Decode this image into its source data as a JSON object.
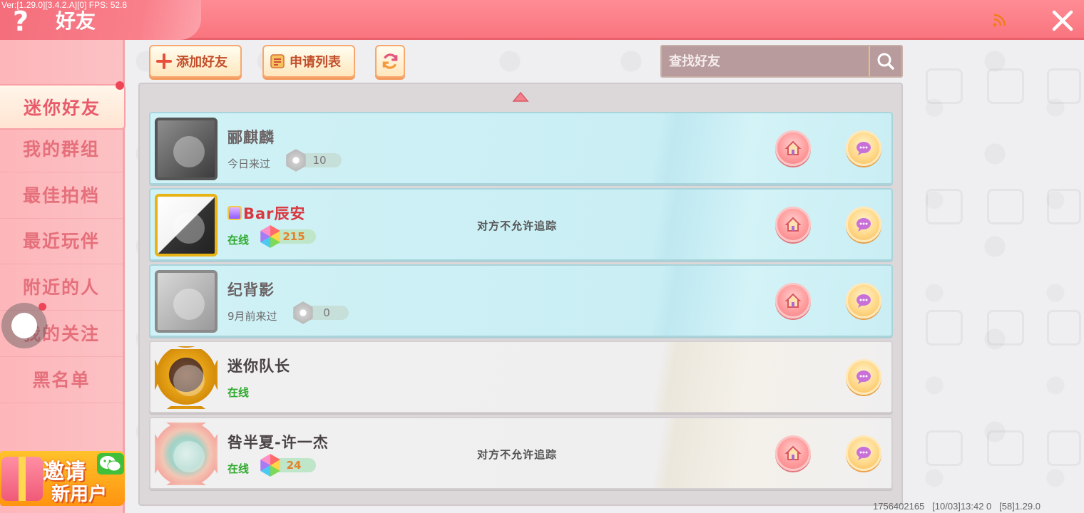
{
  "header": {
    "version_text": "Ver:[1.29.0][3.4.2.A][0] FPS: 52.8",
    "title": "好友",
    "help_icon": "question-mark-icon",
    "signal_icon": "signal-icon",
    "close_icon": "close-icon"
  },
  "sidebar": {
    "items": [
      {
        "label": "迷你好友",
        "active": true
      },
      {
        "label": "我的群组"
      },
      {
        "label": "最佳拍档"
      },
      {
        "label": "最近玩伴"
      },
      {
        "label": "附近的人"
      },
      {
        "label": "我的关注"
      },
      {
        "label": "黑名单"
      }
    ],
    "invite": {
      "line1": "邀请",
      "line2": "新用户"
    }
  },
  "toolbar": {
    "add_friend": "添加好友",
    "request_list": "申请列表",
    "search_placeholder": "查找好友"
  },
  "friends": [
    {
      "name": "郦麒麟",
      "status": "今日来过",
      "score": "10",
      "track": ""
    },
    {
      "name": "Bar辰安",
      "status": "在线",
      "score": "215",
      "track": "对方不允许追踪"
    },
    {
      "name": "纪背影",
      "status": "9月前来过",
      "score": "0",
      "track": ""
    },
    {
      "name": "迷你队长",
      "status": "在线",
      "score": "",
      "track": ""
    },
    {
      "name": "咎半夏-许一杰",
      "status": "在线",
      "score": "24",
      "track": "对方不允许追踪"
    }
  ],
  "footer": {
    "id_text": "1756402165",
    "time_text": "[10/03]13:42 0",
    "ver_text": "[58]1.29.0"
  },
  "colors": {
    "header": "#f9757f",
    "sidebar": "#fdb6ba",
    "row_blue": "#c9eef4",
    "online_green": "#2eaa2c",
    "name_red": "#d9373f"
  }
}
